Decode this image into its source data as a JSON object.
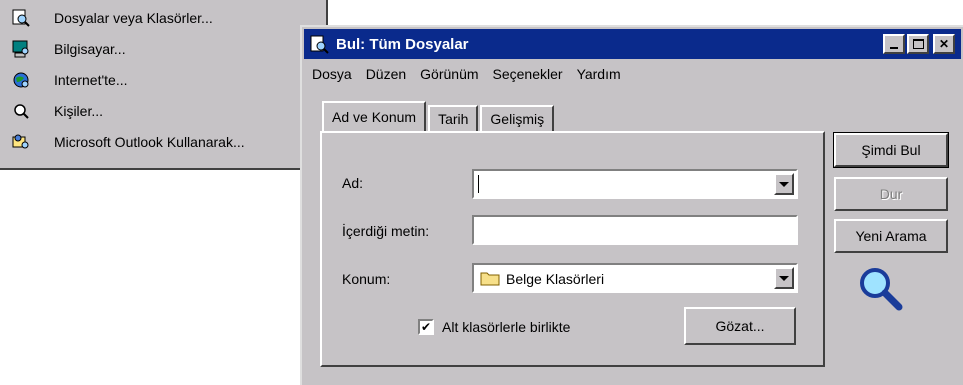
{
  "start_menu": {
    "items": [
      {
        "icon": "find-files-icon",
        "label": "Dosyalar veya Klasörler..."
      },
      {
        "icon": "computer-icon",
        "label": "Bilgisayar..."
      },
      {
        "icon": "internet-icon",
        "label": "Internet'te..."
      },
      {
        "icon": "people-icon",
        "label": "Kişiler..."
      },
      {
        "icon": "outlook-icon",
        "label": "Microsoft Outlook Kullanarak..."
      }
    ]
  },
  "window": {
    "title": "Bul: Tüm Dosyalar",
    "menu": [
      "Dosya",
      "Düzen",
      "Görünüm",
      "Seçenekler",
      "Yardım"
    ],
    "tabs": [
      "Ad ve Konum",
      "Tarih",
      "Gelişmiş"
    ],
    "fields": {
      "name_label": "Ad:",
      "name_value": "",
      "text_label": "İçerdiği metin:",
      "text_value": "",
      "location_label": "Konum:",
      "location_value": "Belge Klasörleri"
    },
    "subfolders_label": "Alt klasörlerle birlikte",
    "subfolders_checked": true,
    "browse_label": "Gözat...",
    "buttons": {
      "find_now": "Şimdi Bul",
      "stop": "Dur",
      "new_search": "Yeni Arama"
    },
    "colors": {
      "title_bar": "#0a2a8c",
      "face": "#c6c3c6"
    }
  }
}
